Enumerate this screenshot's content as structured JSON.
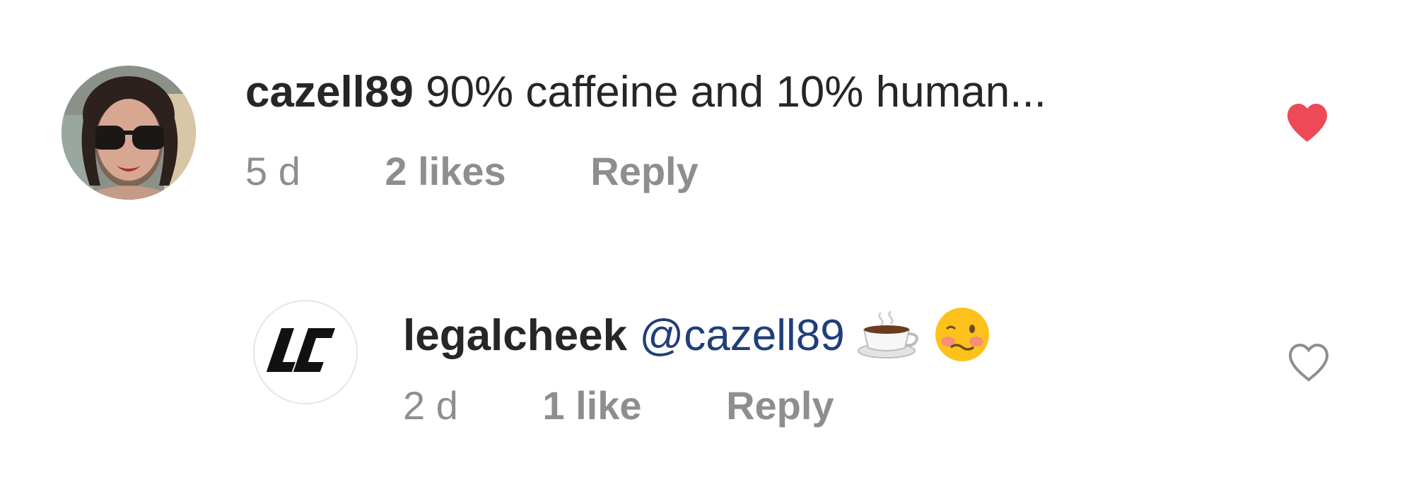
{
  "comments": [
    {
      "username": "cazell89",
      "text": " 90% caffeine and 10% human...",
      "time": "5 d",
      "likes": "2 likes",
      "reply_label": "Reply",
      "liked": true,
      "avatar_icon": "user-photo-avatar-sunglasses"
    },
    {
      "username": "legalcheek",
      "mention": "@cazell89",
      "emojis": [
        "coffee-cup-emoji",
        "woozy-face-emoji"
      ],
      "time": "2 d",
      "likes": "1 like",
      "reply_label": "Reply",
      "liked": false,
      "avatar_icon": "lc-logo-avatar",
      "avatar_logo_text": "LC"
    }
  ],
  "colors": {
    "heart_filled": "#ed4956",
    "heart_outline": "#8e8e8e",
    "text_primary": "#262626",
    "text_secondary": "#8e8e8e",
    "mention": "#1f3f78"
  }
}
